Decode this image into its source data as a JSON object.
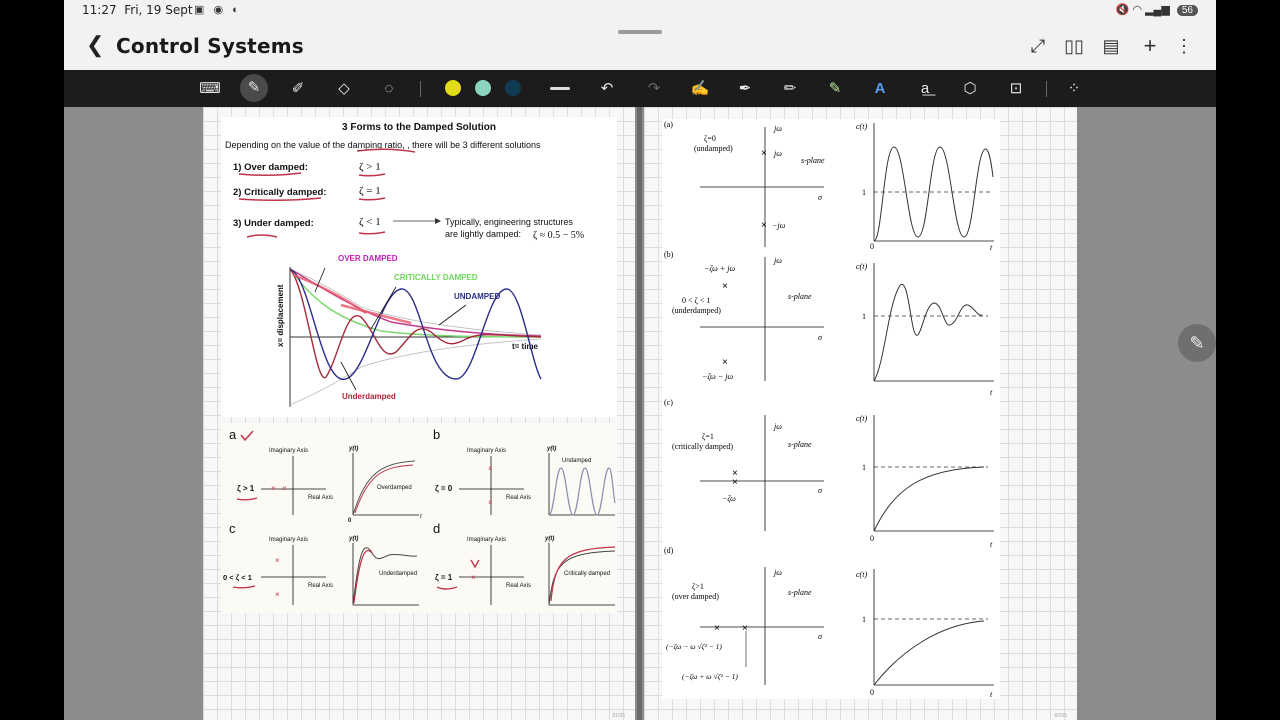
{
  "status_bar": {
    "time": "11:27",
    "date": "Fri, 19 Sept",
    "battery": "56"
  },
  "header": {
    "title": "Control Systems"
  },
  "toolbar": {
    "colors": [
      "#e2dc18",
      "#8cd4c0",
      "#0e3a52"
    ]
  },
  "left_page": {
    "sheet_a": {
      "title": "3 Forms to the Damped Solution",
      "intro": "Depending on the value of the damping ratio, , there will be 3 different solutions",
      "cases": [
        {
          "label": "1) Over damped:",
          "condition": "ζ > 1"
        },
        {
          "label": "2) Critically damped:",
          "condition": "ζ = 1"
        },
        {
          "label": "3) Under damped:",
          "condition": "ζ < 1"
        }
      ],
      "note_line1": "Typically, engineering structures",
      "note_line2": "are lightly damped:",
      "note_value": "ζ ≈ 0.5 − 5%",
      "graph": {
        "over": "OVER DAMPED",
        "critical": "CRITICALLY DAMPED",
        "undamped": "UNDAMPED",
        "under": "Underdamped",
        "ylabel": "x= displacement",
        "xlabel": "t= time"
      }
    },
    "sheet_b": {
      "panels": [
        {
          "letter": "a",
          "imag": "Imaginary Axis",
          "real": "Real Axis",
          "cond": "ζ > 1",
          "yt": "y(t)",
          "curve": "Overdamped"
        },
        {
          "letter": "b",
          "imag": "Imaginary Axis",
          "real": "Real Axis",
          "cond": "ζ = 0",
          "yt": "y(t)",
          "curve": "Undamped"
        },
        {
          "letter": "c",
          "imag": "Imaginary Axis",
          "real": "Real Axis",
          "cond": "0 < ζ < 1",
          "yt": "y(t)",
          "curve": "Underdamped"
        },
        {
          "letter": "d",
          "imag": "Imaginary Axis",
          "real": "Real Axis",
          "cond": "ζ = 1",
          "yt": "y(t)",
          "curve": "Critically damped"
        }
      ],
      "zero": "0",
      "t": "t"
    }
  },
  "right_page": {
    "rows": [
      {
        "tag": "(a)",
        "zeta": "ζ=0",
        "desc": "(undamped)",
        "pole_top": "jω",
        "pole_bot": "−jω",
        "sub": "n"
      },
      {
        "tag": "(b)",
        "zeta": "0 < ζ < 1",
        "desc": "(underdamped)",
        "pole_top": "−ζω",
        "pole_bot": "−ζω",
        "sub": "n"
      },
      {
        "tag": "(c)",
        "zeta": "ζ=1",
        "desc": "(critically damped)",
        "pole_top": "−ζω",
        "pole_bot": "",
        "sub": "n"
      },
      {
        "tag": "(d)",
        "zeta": "ζ>1",
        "desc": "(over damped)",
        "pole_top": "(−ζω",
        "pole_bot": "(−ζω",
        "sub": "n"
      }
    ],
    "axis_jw": "jω",
    "axis_sigma": "σ",
    "splane": "s-plane",
    "ct": "c(t)",
    "one": "1",
    "zero": "0",
    "t": "t",
    "b_top": "−ζω + jω",
    "b_bot": "−ζω − jω",
    "d_left1": "(−ζω − ω √ζ² − 1)",
    "d_left2": "(−ζω + ω √ζ² − 1)"
  }
}
